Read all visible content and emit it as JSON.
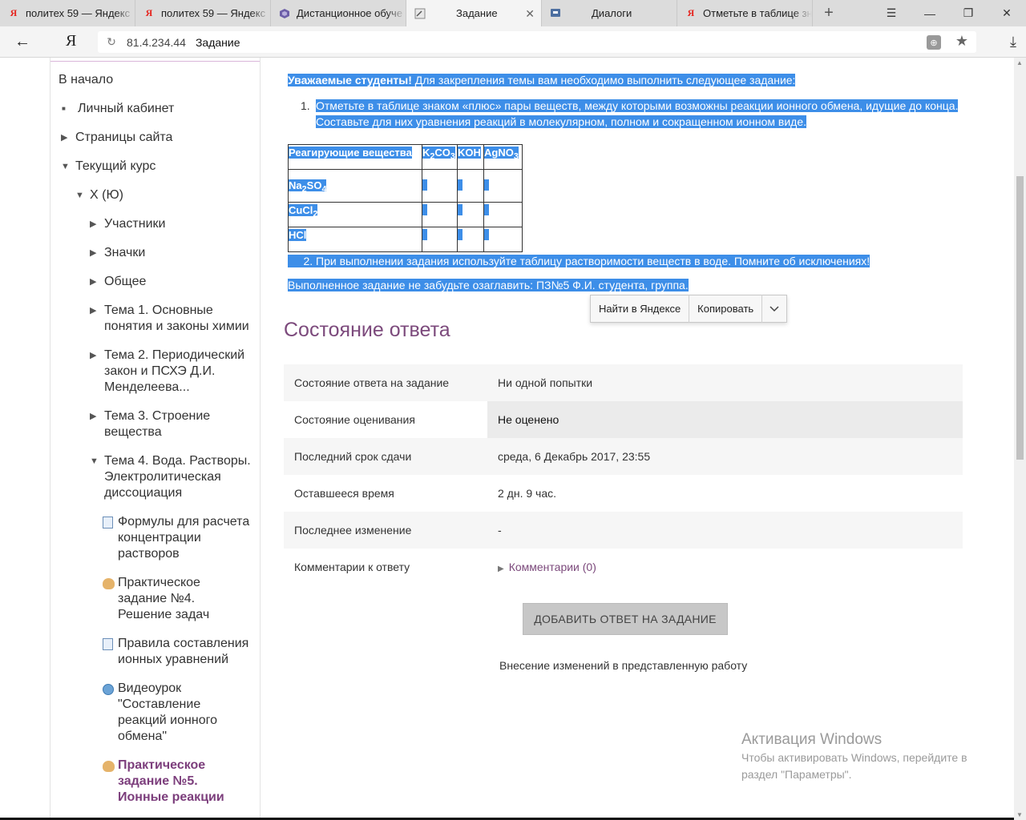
{
  "browser": {
    "tabs": [
      {
        "title": "политех 59 — Яндекс",
        "icon": "yandex-icon"
      },
      {
        "title": "политех 59 — Яндекс",
        "icon": "yandex-icon"
      },
      {
        "title": "Дистанционное обуче",
        "icon": "moodle-icon"
      },
      {
        "title": "Задание",
        "icon": "page-icon",
        "active": true
      },
      {
        "title": "Диалоги",
        "icon": "chat-icon"
      },
      {
        "title": "Отметьте в таблице зн",
        "icon": "yandex-icon"
      }
    ],
    "logo": "Я",
    "url_host": "81.4.234.44",
    "url_title": "Задание"
  },
  "sidebar": {
    "items": [
      {
        "label": "В начало"
      },
      {
        "label": "Личный кабинет"
      },
      {
        "label": "Страницы сайта"
      },
      {
        "label": "Текущий курс"
      },
      {
        "label": "Х (Ю)"
      },
      {
        "label": "Участники"
      },
      {
        "label": "Значки"
      },
      {
        "label": "Общее"
      },
      {
        "label": "Тема 1. Основные понятия и законы химии"
      },
      {
        "label": "Тема 2. Периодический закон и ПСХЭ Д.И. Менделеева..."
      },
      {
        "label": "Тема 3. Строение вещества"
      },
      {
        "label": "Тема 4. Вода. Растворы. Электролитическая диссоциация"
      },
      {
        "label": "Формулы для расчета концентрации растворов"
      },
      {
        "label": "Практическое задание №4. Решение задач"
      },
      {
        "label": "Правила составления ионных уравнений"
      },
      {
        "label": "Видеоурок \"Составление реакций ионного обмена\""
      },
      {
        "label": "Практическое задание №5. Ионные реакции"
      }
    ]
  },
  "task": {
    "intro_bold": "Уважаемые студенты!",
    "intro_text": " Для закрепления темы вам необходимо выполнить следующее задание:",
    "item1_num": "1.",
    "item1_line1": "Отметьте в таблице знаком «плюс» пары веществ, между которыми возможны реакции ионного обмена, идущие до конца.",
    "item1_line2": "Составьте для них уравнения реакций в молекулярном, полном и сокращенном ионном виде.",
    "table": {
      "header": "Реагирующие вещества",
      "col1": {
        "a": "K",
        "a_sub": "2",
        "b": "CO",
        "b_sub": "3"
      },
      "col2": "KOH",
      "col3": {
        "a": "AgNO",
        "a_sub": "3"
      },
      "row1": {
        "a": "Na",
        "a_sub": "2",
        "b": "SO",
        "b_sub": "4"
      },
      "row2": {
        "a": "CuCl",
        "a_sub": "2"
      },
      "row3": "HCl"
    },
    "note": "     2. При выполнении задания используйте таблицу растворимости веществ в воде. Помните об исключениях!",
    "footer": "Выполненное задание не забудьте озаглавить: ПЗ№5 Ф.И. студента, группа."
  },
  "context_popup": {
    "find": "Найти в Яндексе",
    "copy": "Копировать"
  },
  "status": {
    "title": "Состояние ответа",
    "rows": [
      {
        "label": "Состояние ответа на задание",
        "value": "Ни одной попытки"
      },
      {
        "label": "Состояние оценивания",
        "value": "Не оценено"
      },
      {
        "label": "Последний срок сдачи",
        "value": "среда, 6 Декабрь 2017, 23:55"
      },
      {
        "label": "Оставшееся время",
        "value": "2 дн. 9 час."
      },
      {
        "label": "Последнее изменение",
        "value": "-"
      },
      {
        "label": "Комментарии к ответу",
        "value": "Комментарии (0)"
      }
    ],
    "submit_button": "ДОБАВИТЬ ОТВЕТ НА ЗАДАНИЕ",
    "submit_note": "Внесение изменений в представленную работу"
  },
  "watermark": {
    "title": "Активация Windows",
    "text": "Чтобы активировать Windows, перейдите в раздел \"Параметры\"."
  }
}
